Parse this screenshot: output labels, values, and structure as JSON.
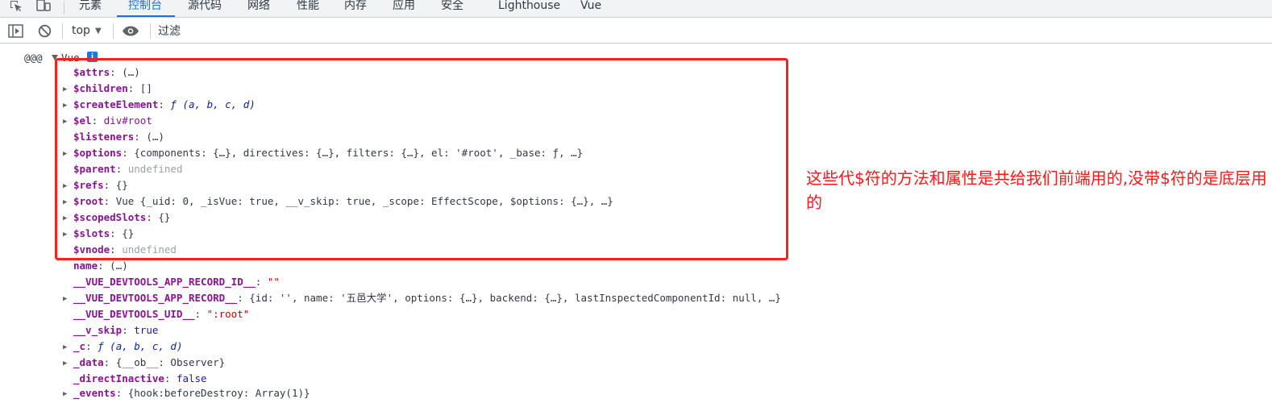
{
  "devtools": {
    "tabs": [
      "元素",
      "控制台",
      "源代码",
      "网络",
      "性能",
      "内存",
      "应用",
      "安全",
      "Lighthouse",
      "Vue"
    ],
    "active_tab": "控制台"
  },
  "toolbar": {
    "context": "top",
    "filter_placeholder": "过滤"
  },
  "console": {
    "log_prefix": "@@@",
    "object_label": "Vue",
    "info_badge": "i",
    "rows": [
      {
        "key": "$attrs",
        "value": "(…)"
      },
      {
        "key": "$children",
        "value": "[]"
      },
      {
        "key": "$createElement",
        "value": "ƒ (a, b, c, d)"
      },
      {
        "key": "$el",
        "value": "div#root"
      },
      {
        "key": "$listeners",
        "value": "(…)"
      },
      {
        "key": "$options",
        "value": "{components: {…}, directives: {…}, filters: {…}, el: '#root', _base: ƒ, …}"
      },
      {
        "key": "$parent",
        "value": "undefined"
      },
      {
        "key": "$refs",
        "value": "{}"
      },
      {
        "key": "$root",
        "value": "Vue {_uid: 0, _isVue: true, __v_skip: true, _scope: EffectScope, $options: {…}, …}"
      },
      {
        "key": "$scopedSlots",
        "value": "{}"
      },
      {
        "key": "$slots",
        "value": "{}"
      },
      {
        "key": "$vnode",
        "value": "undefined"
      },
      {
        "key": "name",
        "value": "(…)"
      },
      {
        "key": "__VUE_DEVTOOLS_APP_RECORD_ID__",
        "value": "\"\""
      },
      {
        "key": "__VUE_DEVTOOLS_APP_RECORD__",
        "value": "{id: '', name: '五邑大学', options: {…}, backend: {…}, lastInspectedComponentId: null, …}"
      },
      {
        "key": "__VUE_DEVTOOLS_UID__",
        "value": "\":root\""
      },
      {
        "key": "__v_skip",
        "value": "true"
      },
      {
        "key": "_c",
        "value": "ƒ (a, b, c, d)"
      },
      {
        "key": "_data",
        "value": "{__ob__: Observer}"
      },
      {
        "key": "_directInactive",
        "value": "false"
      },
      {
        "key": "_events",
        "value": "{hook:beforeDestroy: Array(1)}"
      }
    ]
  },
  "annotation": {
    "text": "这些代$符的方法和属性是共给我们前端用的,没带$符的是底层用的",
    "color": "#ff1a1a"
  }
}
